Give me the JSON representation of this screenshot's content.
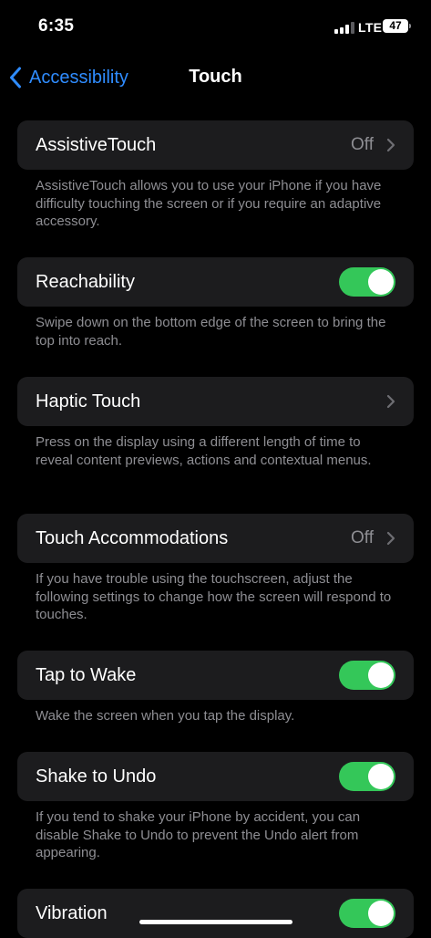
{
  "status_bar": {
    "time": "6:35",
    "network": "LTE",
    "battery_level": "47",
    "signal_bars_filled": 3,
    "signal_bars_total": 4
  },
  "nav": {
    "back_label": "Accessibility",
    "title": "Touch"
  },
  "settings": {
    "assistive_touch": {
      "label": "AssistiveTouch",
      "value": "Off",
      "footer": "AssistiveTouch allows you to use your iPhone if you have difficulty touching the screen or if you require an adaptive accessory."
    },
    "reachability": {
      "label": "Reachability",
      "enabled": true,
      "footer": "Swipe down on the bottom edge of the screen to bring the top into reach."
    },
    "haptic_touch": {
      "label": "Haptic Touch",
      "footer": "Press on the display using a different length of time to reveal content previews, actions and contextual menus."
    },
    "touch_accommodations": {
      "label": "Touch Accommodations",
      "value": "Off",
      "footer": "If you have trouble using the touchscreen, adjust the following settings to change how the screen will respond to touches."
    },
    "tap_to_wake": {
      "label": "Tap to Wake",
      "enabled": true,
      "footer": "Wake the screen when you tap the display."
    },
    "shake_to_undo": {
      "label": "Shake to Undo",
      "enabled": true,
      "footer": "If you tend to shake your iPhone by accident, you can disable Shake to Undo to prevent the Undo alert from appearing."
    },
    "vibration": {
      "label": "Vibration",
      "enabled": true
    }
  },
  "colors": {
    "accent": "#2f8cff",
    "toggle_on": "#34c759",
    "cell_background": "#1c1c1e",
    "secondary_text": "#8e8e93"
  }
}
